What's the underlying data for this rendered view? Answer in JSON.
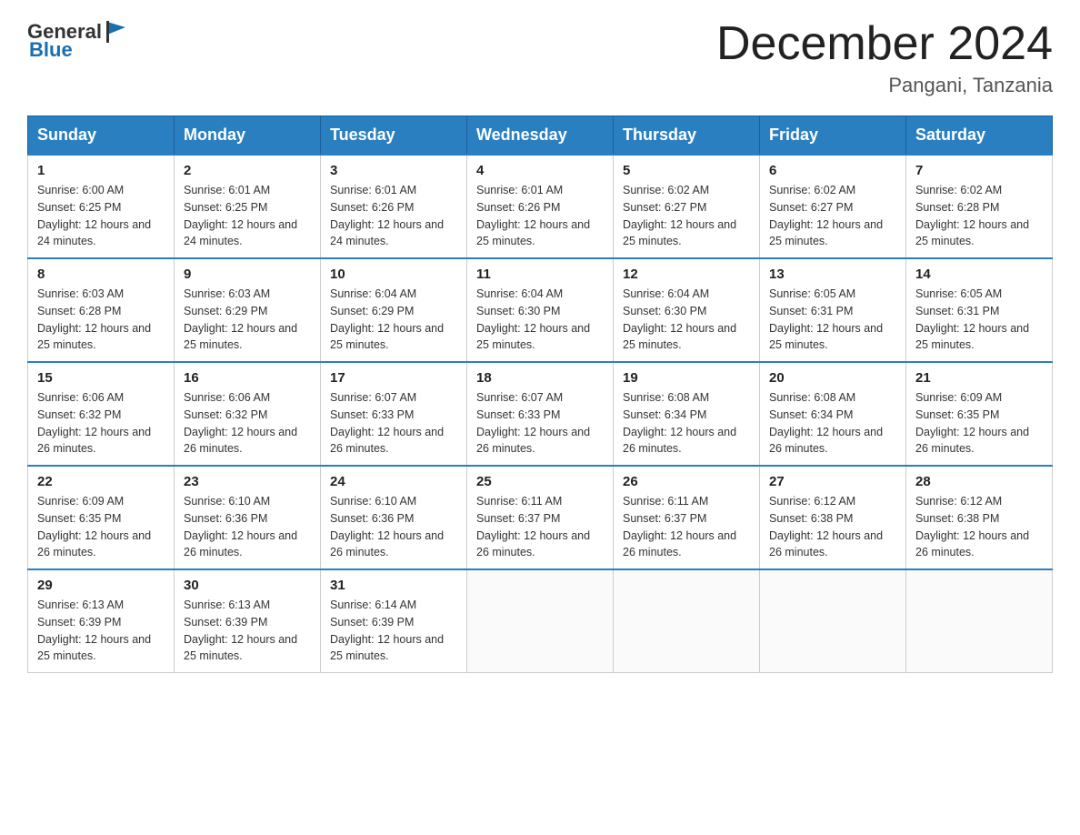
{
  "header": {
    "logo": {
      "general": "General",
      "blue": "Blue"
    },
    "title": "December 2024",
    "location": "Pangani, Tanzania"
  },
  "weekdays": [
    "Sunday",
    "Monday",
    "Tuesday",
    "Wednesday",
    "Thursday",
    "Friday",
    "Saturday"
  ],
  "weeks": [
    [
      {
        "day": "1",
        "sunrise": "6:00 AM",
        "sunset": "6:25 PM",
        "daylight": "12 hours and 24 minutes."
      },
      {
        "day": "2",
        "sunrise": "6:01 AM",
        "sunset": "6:25 PM",
        "daylight": "12 hours and 24 minutes."
      },
      {
        "day": "3",
        "sunrise": "6:01 AM",
        "sunset": "6:26 PM",
        "daylight": "12 hours and 24 minutes."
      },
      {
        "day": "4",
        "sunrise": "6:01 AM",
        "sunset": "6:26 PM",
        "daylight": "12 hours and 25 minutes."
      },
      {
        "day": "5",
        "sunrise": "6:02 AM",
        "sunset": "6:27 PM",
        "daylight": "12 hours and 25 minutes."
      },
      {
        "day": "6",
        "sunrise": "6:02 AM",
        "sunset": "6:27 PM",
        "daylight": "12 hours and 25 minutes."
      },
      {
        "day": "7",
        "sunrise": "6:02 AM",
        "sunset": "6:28 PM",
        "daylight": "12 hours and 25 minutes."
      }
    ],
    [
      {
        "day": "8",
        "sunrise": "6:03 AM",
        "sunset": "6:28 PM",
        "daylight": "12 hours and 25 minutes."
      },
      {
        "day": "9",
        "sunrise": "6:03 AM",
        "sunset": "6:29 PM",
        "daylight": "12 hours and 25 minutes."
      },
      {
        "day": "10",
        "sunrise": "6:04 AM",
        "sunset": "6:29 PM",
        "daylight": "12 hours and 25 minutes."
      },
      {
        "day": "11",
        "sunrise": "6:04 AM",
        "sunset": "6:30 PM",
        "daylight": "12 hours and 25 minutes."
      },
      {
        "day": "12",
        "sunrise": "6:04 AM",
        "sunset": "6:30 PM",
        "daylight": "12 hours and 25 minutes."
      },
      {
        "day": "13",
        "sunrise": "6:05 AM",
        "sunset": "6:31 PM",
        "daylight": "12 hours and 25 minutes."
      },
      {
        "day": "14",
        "sunrise": "6:05 AM",
        "sunset": "6:31 PM",
        "daylight": "12 hours and 25 minutes."
      }
    ],
    [
      {
        "day": "15",
        "sunrise": "6:06 AM",
        "sunset": "6:32 PM",
        "daylight": "12 hours and 26 minutes."
      },
      {
        "day": "16",
        "sunrise": "6:06 AM",
        "sunset": "6:32 PM",
        "daylight": "12 hours and 26 minutes."
      },
      {
        "day": "17",
        "sunrise": "6:07 AM",
        "sunset": "6:33 PM",
        "daylight": "12 hours and 26 minutes."
      },
      {
        "day": "18",
        "sunrise": "6:07 AM",
        "sunset": "6:33 PM",
        "daylight": "12 hours and 26 minutes."
      },
      {
        "day": "19",
        "sunrise": "6:08 AM",
        "sunset": "6:34 PM",
        "daylight": "12 hours and 26 minutes."
      },
      {
        "day": "20",
        "sunrise": "6:08 AM",
        "sunset": "6:34 PM",
        "daylight": "12 hours and 26 minutes."
      },
      {
        "day": "21",
        "sunrise": "6:09 AM",
        "sunset": "6:35 PM",
        "daylight": "12 hours and 26 minutes."
      }
    ],
    [
      {
        "day": "22",
        "sunrise": "6:09 AM",
        "sunset": "6:35 PM",
        "daylight": "12 hours and 26 minutes."
      },
      {
        "day": "23",
        "sunrise": "6:10 AM",
        "sunset": "6:36 PM",
        "daylight": "12 hours and 26 minutes."
      },
      {
        "day": "24",
        "sunrise": "6:10 AM",
        "sunset": "6:36 PM",
        "daylight": "12 hours and 26 minutes."
      },
      {
        "day": "25",
        "sunrise": "6:11 AM",
        "sunset": "6:37 PM",
        "daylight": "12 hours and 26 minutes."
      },
      {
        "day": "26",
        "sunrise": "6:11 AM",
        "sunset": "6:37 PM",
        "daylight": "12 hours and 26 minutes."
      },
      {
        "day": "27",
        "sunrise": "6:12 AM",
        "sunset": "6:38 PM",
        "daylight": "12 hours and 26 minutes."
      },
      {
        "day": "28",
        "sunrise": "6:12 AM",
        "sunset": "6:38 PM",
        "daylight": "12 hours and 26 minutes."
      }
    ],
    [
      {
        "day": "29",
        "sunrise": "6:13 AM",
        "sunset": "6:39 PM",
        "daylight": "12 hours and 25 minutes."
      },
      {
        "day": "30",
        "sunrise": "6:13 AM",
        "sunset": "6:39 PM",
        "daylight": "12 hours and 25 minutes."
      },
      {
        "day": "31",
        "sunrise": "6:14 AM",
        "sunset": "6:39 PM",
        "daylight": "12 hours and 25 minutes."
      },
      null,
      null,
      null,
      null
    ]
  ],
  "labels": {
    "sunrise": "Sunrise:",
    "sunset": "Sunset:",
    "daylight": "Daylight:"
  }
}
